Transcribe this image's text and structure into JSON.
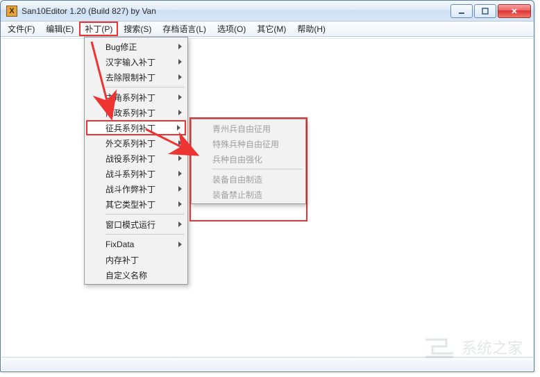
{
  "window": {
    "title": "San10Editor 1.20 (Build 827) by Van",
    "icon_letter": "X"
  },
  "menubar": {
    "items": [
      {
        "label": "文件(F)"
      },
      {
        "label": "编辑(E)"
      },
      {
        "label": "补丁(P)",
        "active": true
      },
      {
        "label": "搜索(S)"
      },
      {
        "label": "存档语言(L)"
      },
      {
        "label": "选项(O)"
      },
      {
        "label": "其它(M)"
      },
      {
        "label": "帮助(H)"
      }
    ]
  },
  "dropdown": {
    "groups": [
      [
        {
          "label": "Bug修正",
          "submenu": true
        },
        {
          "label": "汉字输入补丁",
          "submenu": true
        },
        {
          "label": "去除限制补丁",
          "submenu": true
        }
      ],
      [
        {
          "label": "主角系列补丁",
          "submenu": true
        },
        {
          "label": "内政系列补丁",
          "submenu": true
        },
        {
          "label": "征兵系列补丁",
          "submenu": true,
          "highlight": true
        },
        {
          "label": "外交系列补丁",
          "submenu": true
        },
        {
          "label": "战役系列补丁",
          "submenu": true
        },
        {
          "label": "战斗系列补丁",
          "submenu": true
        },
        {
          "label": "战斗作弊补丁",
          "submenu": true
        },
        {
          "label": "其它类型补丁",
          "submenu": true
        }
      ],
      [
        {
          "label": "窗口模式运行",
          "submenu": true
        }
      ],
      [
        {
          "label": "FixData",
          "submenu": true
        },
        {
          "label": "内存补丁"
        },
        {
          "label": "自定义名称"
        }
      ]
    ]
  },
  "submenu": {
    "items": [
      {
        "label": "青州兵自由征用",
        "disabled": true
      },
      {
        "label": "特殊兵种自由征用",
        "disabled": true
      },
      {
        "label": "兵种自由强化",
        "disabled": true
      },
      {
        "sep": true
      },
      {
        "label": "装备自由制造",
        "disabled": true
      },
      {
        "label": "装备禁止制造",
        "disabled": true
      }
    ]
  }
}
